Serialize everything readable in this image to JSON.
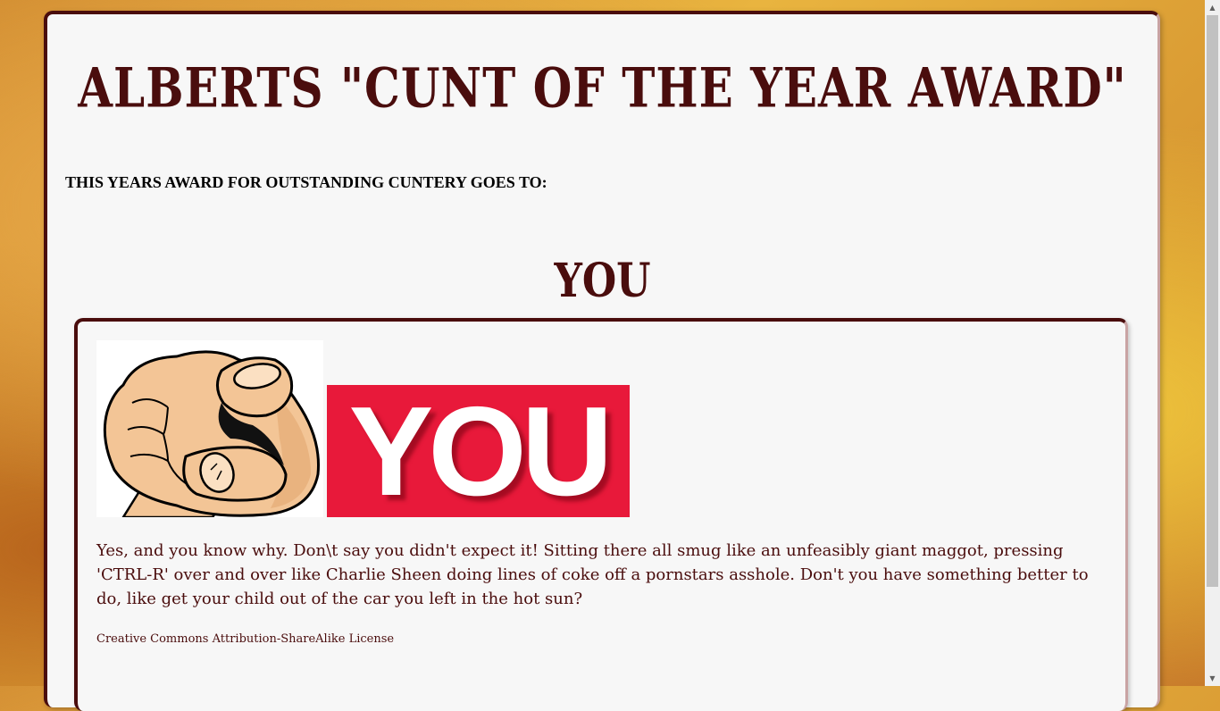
{
  "header": {
    "title": "ALBERTS \"CUNT OF THE YEAR AWARD\""
  },
  "award": {
    "intro": "THIS YEARS AWARD FOR OUTSTANDING CUNTERY GOES TO:",
    "winner": "YOU"
  },
  "card": {
    "banner_text": "YOU",
    "body": "Yes, and you know why. Don\\t say you didn't expect it! Sitting there all smug like an unfeasibly giant maggot, pressing 'CTRL-R' over and over like Charlie Sheen doing lines of coke off a pornstars asshole. Don't you have something better to do, like get your child out of the car you left in the hot sun?",
    "license": "Creative Commons Attribution-ShareAlike License"
  },
  "colors": {
    "accent": "#4a0d0d",
    "banner_red": "#e8193a",
    "background_gold": "#e9b43f"
  },
  "icons": {
    "hand": "pointing-hand-icon",
    "scroll_up": "chevron-up-icon",
    "scroll_down": "chevron-down-icon"
  }
}
